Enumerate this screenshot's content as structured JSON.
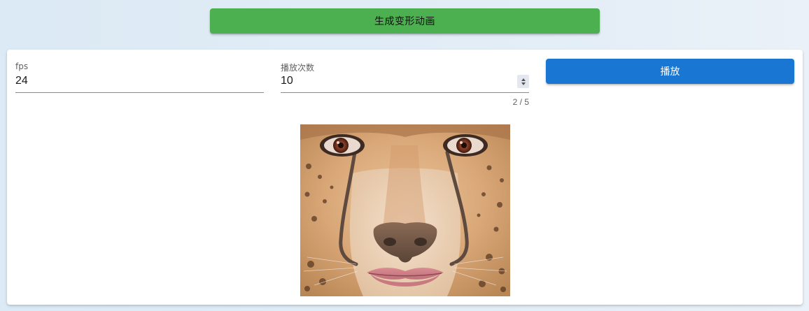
{
  "header": {
    "generate_label": "生成变形动画"
  },
  "controls": {
    "fps": {
      "label": "fps",
      "value": "24"
    },
    "loops": {
      "label": "播放次数",
      "value": "10",
      "counter": "2 / 5"
    },
    "play_label": "播放"
  },
  "colors": {
    "generate_button": "#4caf50",
    "play_button": "#1976d2",
    "card_background": "#ffffff",
    "page_background": "#dfebf5"
  },
  "preview": {
    "description_icon": "morph-face-image"
  }
}
